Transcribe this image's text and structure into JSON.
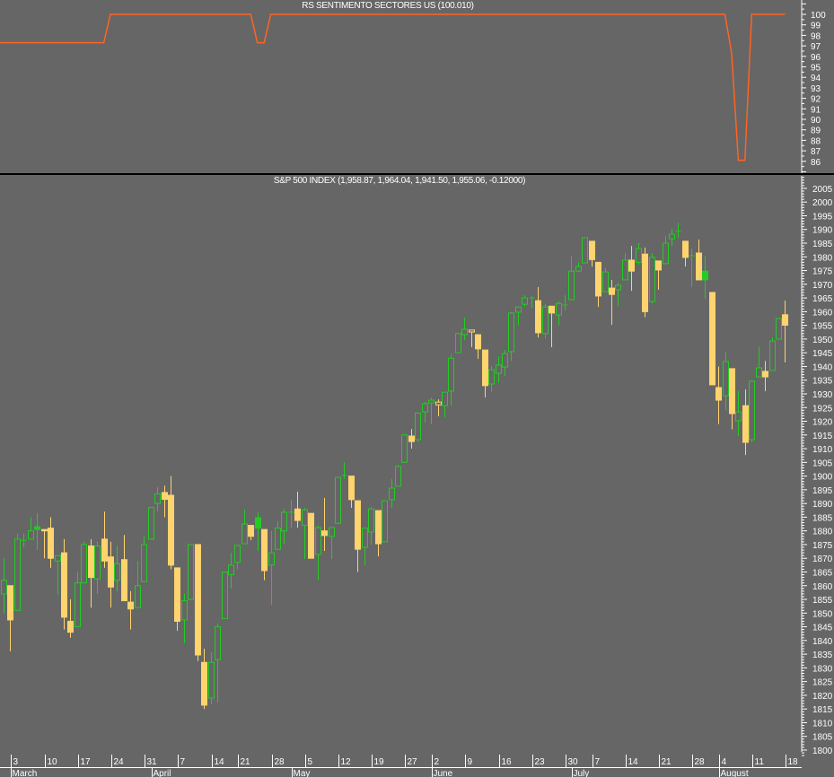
{
  "top_panel": {
    "title": "RS SENTIMENTO SECTORES US (100.010)"
  },
  "main_panel": {
    "title": "S&P 500 INDEX (1,958.87, 1,964.04, 1,941.50, 1,955.06, -0.12000)"
  },
  "colors": {
    "background": "#666666",
    "up": "#22cc22",
    "down": "#ffd36e",
    "rs_line": "#ff6420",
    "axis": "#ffffff",
    "separator": "#000000"
  },
  "date_axis": {
    "day_labels": [
      {
        "label": "3",
        "index": 1
      },
      {
        "label": "10",
        "index": 6
      },
      {
        "label": "17",
        "index": 11
      },
      {
        "label": "24",
        "index": 16
      },
      {
        "label": "31",
        "index": 21
      },
      {
        "label": "7",
        "index": 26
      },
      {
        "label": "14",
        "index": 31
      },
      {
        "label": "21",
        "index": 35
      },
      {
        "label": "28",
        "index": 40
      },
      {
        "label": "5",
        "index": 45
      },
      {
        "label": "12",
        "index": 50
      },
      {
        "label": "19",
        "index": 55
      },
      {
        "label": "27",
        "index": 60
      },
      {
        "label": "2",
        "index": 64
      },
      {
        "label": "9",
        "index": 69
      },
      {
        "label": "16",
        "index": 74
      },
      {
        "label": "23",
        "index": 79
      },
      {
        "label": "30",
        "index": 84
      },
      {
        "label": "7",
        "index": 88
      },
      {
        "label": "14",
        "index": 93
      },
      {
        "label": "21",
        "index": 98
      },
      {
        "label": "28",
        "index": 103
      },
      {
        "label": "4",
        "index": 107
      },
      {
        "label": "11",
        "index": 112
      },
      {
        "label": "18",
        "index": 117
      }
    ],
    "month_labels": [
      {
        "label": "March",
        "index": 1
      },
      {
        "label": "April",
        "index": 22
      },
      {
        "label": "May",
        "index": 43
      },
      {
        "label": "June",
        "index": 64
      },
      {
        "label": "July",
        "index": 85
      },
      {
        "label": "August",
        "index": 107
      }
    ]
  },
  "chart_data": [
    {
      "type": "line",
      "title": "RS SENTIMENTO SECTORES US (100.010)",
      "ylim": [
        84.6,
        101.4
      ],
      "yticks": [
        100,
        99,
        98,
        97,
        96,
        95,
        94,
        93,
        92,
        91,
        90,
        89,
        88,
        87,
        86
      ],
      "series": [
        {
          "name": "RS SENTIMENTO SECTORES US",
          "values": [
            97.3,
            97.3,
            97.3,
            97.3,
            97.3,
            97.3,
            97.3,
            97.3,
            97.3,
            97.3,
            97.3,
            97.3,
            97.3,
            97.3,
            97.3,
            97.3,
            100,
            100,
            100,
            100,
            100,
            100,
            100,
            100,
            100,
            100,
            100,
            100,
            100,
            100,
            100,
            100,
            100,
            100,
            100,
            100,
            100,
            100,
            97.3,
            97.3,
            100,
            100,
            100,
            100,
            100,
            100,
            100,
            100,
            100,
            100,
            100,
            100,
            100,
            100,
            100,
            100,
            100,
            100,
            100,
            100,
            100,
            100,
            100,
            100,
            100,
            100,
            100,
            100,
            100,
            100,
            100,
            100,
            100,
            100,
            100,
            100,
            100,
            100,
            100,
            100,
            100,
            100,
            100,
            100,
            100,
            100,
            100,
            100,
            100,
            100,
            100,
            100,
            100,
            100,
            100,
            100,
            100,
            100,
            100,
            100,
            100,
            100,
            100,
            100,
            100,
            100,
            100,
            100,
            100,
            96.3,
            86.1,
            86.1,
            100,
            100,
            100,
            100,
            100,
            100
          ]
        }
      ]
    },
    {
      "type": "candlestick",
      "title": "S&P 500 INDEX (1,958.87, 1,964.04, 1,941.50, 1,955.06, -0.12000)",
      "ylim": [
        1797.5,
        2009
      ],
      "yticks": [
        2005,
        2000,
        1995,
        1990,
        1985,
        1980,
        1975,
        1970,
        1965,
        1960,
        1955,
        1950,
        1945,
        1940,
        1935,
        1930,
        1925,
        1920,
        1915,
        1910,
        1905,
        1900,
        1895,
        1890,
        1885,
        1880,
        1875,
        1870,
        1865,
        1860,
        1855,
        1850,
        1845,
        1840,
        1835,
        1830,
        1825,
        1820,
        1815,
        1810,
        1805,
        1800
      ],
      "ohlc_fields": [
        "open",
        "high",
        "low",
        "close"
      ],
      "filled_up_indices": [
        5,
        38,
        105
      ],
      "hollow_down_indices": [
        65,
        70
      ],
      "ohlc": [
        [
          1857,
          1870,
          1850,
          1862
        ],
        [
          1860,
          1860,
          1836,
          1847.5
        ],
        [
          1851,
          1879,
          1851,
          1877
        ],
        [
          1876.5,
          1879,
          1874,
          1876.5
        ],
        [
          1877,
          1885,
          1877,
          1880
        ],
        [
          1880.5,
          1886.5,
          1873,
          1881.5
        ],
        [
          1880.5,
          1880.5,
          1870,
          1880
        ],
        [
          1881,
          1885,
          1866.5,
          1870
        ],
        [
          1869,
          1871,
          1856.6,
          1871
        ],
        [
          1872,
          1877,
          1844,
          1848.5
        ],
        [
          1847,
          1855,
          1841,
          1843
        ],
        [
          1845,
          1865,
          1845,
          1861
        ],
        [
          1861,
          1876,
          1861,
          1875
        ],
        [
          1874.5,
          1877,
          1852,
          1863
        ],
        [
          1862.5,
          1876,
          1857,
          1874.5
        ],
        [
          1877,
          1887,
          1866.5,
          1869
        ],
        [
          1870.5,
          1876,
          1852,
          1859.5
        ],
        [
          1862,
          1874.5,
          1858,
          1868
        ],
        [
          1869.5,
          1878.5,
          1854.5,
          1854.5
        ],
        [
          1854,
          1858,
          1844,
          1851.5
        ],
        [
          1852,
          1869,
          1852,
          1860
        ],
        [
          1861.5,
          1878,
          1861.5,
          1875
        ],
        [
          1877,
          1888.5,
          1877,
          1888.5
        ],
        [
          1890,
          1896,
          1887,
          1893.5
        ],
        [
          1894,
          1896.5,
          1885,
          1891.5
        ],
        [
          1893,
          1900,
          1866,
          1867.5
        ],
        [
          1866.5,
          1866.5,
          1843.5,
          1847
        ],
        [
          1847.5,
          1857,
          1839,
          1854.5
        ],
        [
          1855,
          1875,
          1855,
          1875
        ],
        [
          1875,
          1875,
          1832.5,
          1834.7
        ],
        [
          1832,
          1837,
          1815,
          1816.4
        ],
        [
          1819,
          1835.7,
          1816.7,
          1832
        ],
        [
          1833,
          1846,
          1817.4,
          1845
        ],
        [
          1848,
          1865,
          1848,
          1865
        ],
        [
          1864,
          1872,
          1859,
          1867.5
        ],
        [
          1868.5,
          1874.7,
          1866,
          1874.7
        ],
        [
          1875.3,
          1887.7,
          1875.3,
          1882.5
        ],
        [
          1882,
          1882,
          1876.6,
          1878
        ],
        [
          1881,
          1886.8,
          1872.7,
          1884.8
        ],
        [
          1880.5,
          1880.5,
          1862,
          1865.5
        ],
        [
          1867.5,
          1880,
          1853,
          1872
        ],
        [
          1873.3,
          1883.5,
          1873.3,
          1881
        ],
        [
          1880,
          1888,
          1875.3,
          1886.8
        ],
        [
          1886.8,
          1891.4,
          1881,
          1886.8
        ],
        [
          1888,
          1894.3,
          1881.2,
          1883.8
        ],
        [
          1882,
          1888.4,
          1869.7,
          1887.7
        ],
        [
          1886.4,
          1886.4,
          1870,
          1870
        ],
        [
          1871.4,
          1881.9,
          1862,
          1881.2
        ],
        [
          1880,
          1892,
          1872.7,
          1878.3
        ],
        [
          1878,
          1881.2,
          1869.7,
          1881.2
        ],
        [
          1882.8,
          1899.5,
          1882.8,
          1899.5
        ],
        [
          1900,
          1905,
          1899,
          1900.2
        ],
        [
          1900,
          1900,
          1888.4,
          1891.4
        ],
        [
          1891,
          1891,
          1865,
          1873.3
        ],
        [
          1874,
          1881,
          1867.4,
          1881
        ],
        [
          1879.6,
          1888.7,
          1875,
          1888
        ],
        [
          1887.4,
          1887.4,
          1870.7,
          1875.3
        ],
        [
          1876,
          1891,
          1876,
          1891
        ],
        [
          1891.4,
          1899,
          1888.4,
          1895.6
        ],
        [
          1896.3,
          1904,
          1896.3,
          1903.5
        ],
        [
          1905,
          1915.3,
          1905,
          1915
        ],
        [
          1914.6,
          1917.2,
          1910,
          1912.6
        ],
        [
          1913.3,
          1923,
          1912.6,
          1923
        ],
        [
          1923.4,
          1927,
          1919.5,
          1926.4
        ],
        [
          1926.7,
          1928.7,
          1918.9,
          1927.7
        ],
        [
          1927,
          1928,
          1921.8,
          1926
        ],
        [
          1925.7,
          1930.6,
          1921.5,
          1930.6
        ],
        [
          1931,
          1944.4,
          1925.7,
          1943
        ],
        [
          1945,
          1952,
          1945,
          1952
        ],
        [
          1951.6,
          1957.8,
          1949.6,
          1953.6
        ],
        [
          1953.3,
          1953.3,
          1947,
          1952.6
        ],
        [
          1951.6,
          1951.6,
          1942.8,
          1946.4
        ],
        [
          1946,
          1946,
          1928.7,
          1933
        ],
        [
          1933.6,
          1940.1,
          1930.6,
          1938.8
        ],
        [
          1937.5,
          1943.7,
          1934,
          1940.5
        ],
        [
          1939.8,
          1946,
          1936.5,
          1944.7
        ],
        [
          1945.4,
          1960,
          1942,
          1959.5
        ],
        [
          1959.8,
          1961.7,
          1955,
          1961.7
        ],
        [
          1962.7,
          1966,
          1961.7,
          1965
        ],
        [
          1965,
          1965.7,
          1961.4,
          1965
        ],
        [
          1964,
          1969,
          1950.6,
          1952.3
        ],
        [
          1952,
          1962.7,
          1950.3,
          1961.7
        ],
        [
          1962,
          1962,
          1947,
          1959.5
        ],
        [
          1958.8,
          1963.7,
          1955,
          1963
        ],
        [
          1962.4,
          1966,
          1960.4,
          1962.4
        ],
        [
          1964.4,
          1980.4,
          1964.4,
          1974.8
        ],
        [
          1974.8,
          1978,
          1974.5,
          1976.5
        ],
        [
          1977.8,
          1987,
          1977.8,
          1987
        ],
        [
          1985.7,
          1985.7,
          1976.5,
          1979
        ],
        [
          1978,
          1978,
          1961.7,
          1965.7
        ],
        [
          1967.3,
          1976,
          1967.3,
          1974.5
        ],
        [
          1968.6,
          1971.6,
          1955.2,
          1966.3
        ],
        [
          1968,
          1970.6,
          1962,
          1969.6
        ],
        [
          1971.6,
          1981.4,
          1971.6,
          1978.8
        ],
        [
          1978.8,
          1984,
          1967.6,
          1974.8
        ],
        [
          1978,
          1985,
          1977.2,
          1983
        ],
        [
          1981,
          1983.4,
          1958,
          1960
        ],
        [
          1963.7,
          1981.4,
          1963,
          1979.8
        ],
        [
          1978.5,
          1978.5,
          1968,
          1975.2
        ],
        [
          1977.5,
          1987.6,
          1977.5,
          1985
        ],
        [
          1986.6,
          1990.2,
          1984,
          1988.3
        ],
        [
          1989.3,
          1992.5,
          1987,
          1989.3
        ],
        [
          1985.7,
          1985.7,
          1976.5,
          1979.8
        ],
        [
          1980,
          1983,
          1969,
          1980.4
        ],
        [
          1981.4,
          1986.3,
          1971.6,
          1971.6
        ],
        [
          1971.6,
          1980.4,
          1964.7,
          1974.8
        ],
        [
          1967,
          1967,
          1933.3,
          1933.3
        ],
        [
          1932.3,
          1940,
          1919,
          1927.7
        ],
        [
          1929.3,
          1945.4,
          1924,
          1941.8
        ],
        [
          1939.2,
          1939.2,
          1917,
          1922.8
        ],
        [
          1920.2,
          1931,
          1914.6,
          1923.4
        ],
        [
          1925.7,
          1931.6,
          1907.7,
          1912.3
        ],
        [
          1913.3,
          1935,
          1912.3,
          1934.6
        ],
        [
          1936.2,
          1947.3,
          1936.2,
          1939.5
        ],
        [
          1938.2,
          1942,
          1931,
          1936.2
        ],
        [
          1938.5,
          1950.6,
          1938.5,
          1949.3
        ],
        [
          1950,
          1957.5,
          1950,
          1957.5
        ],
        [
          1958.87,
          1964.04,
          1941.5,
          1955.06
        ]
      ]
    }
  ]
}
